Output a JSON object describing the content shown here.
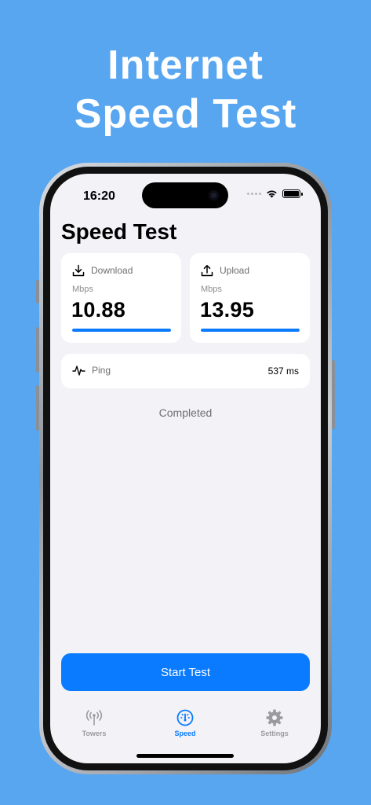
{
  "headline": {
    "line1": "Internet",
    "line2": "Speed Test"
  },
  "status_bar": {
    "time": "16:20"
  },
  "page": {
    "title": "Speed Test"
  },
  "download": {
    "label": "Download",
    "unit": "Mbps",
    "value": "10.88",
    "progress": 1.0,
    "icon": "download-icon"
  },
  "upload": {
    "label": "Upload",
    "unit": "Mbps",
    "value": "13.95",
    "progress": 1.0,
    "icon": "upload-icon"
  },
  "ping": {
    "label": "Ping",
    "value": "537 ms",
    "icon": "pulse-icon"
  },
  "status": "Completed",
  "start_button": {
    "label": "Start Test"
  },
  "tabs": [
    {
      "label": "Towers",
      "icon": "antenna-icon",
      "active": false
    },
    {
      "label": "Speed",
      "icon": "speedometer-icon",
      "active": true
    },
    {
      "label": "Settings",
      "icon": "gear-icon",
      "active": false
    }
  ],
  "colors": {
    "background": "#58a6f0",
    "accent": "#0a7aff",
    "screen": "#f2f2f7"
  }
}
